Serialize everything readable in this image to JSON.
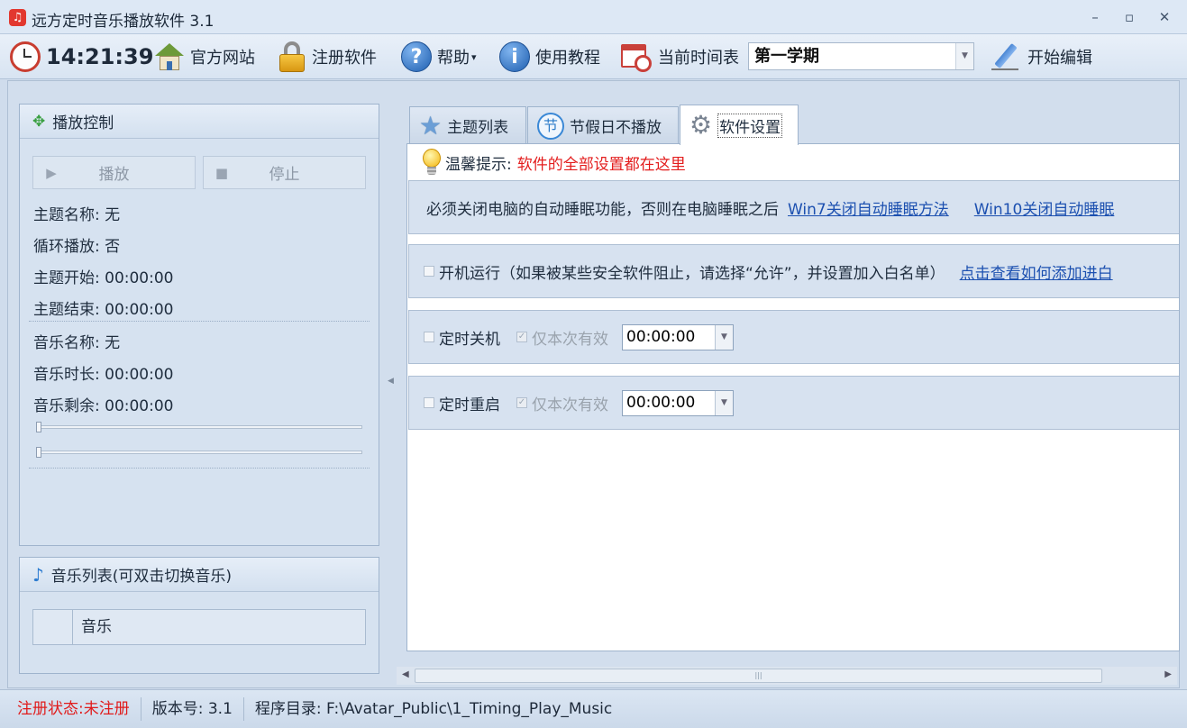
{
  "window": {
    "title": "远方定时音乐播放软件 3.1",
    "minimize": "–",
    "maximize": "▫",
    "close": "✕"
  },
  "toolbar": {
    "clock_time": "14:21:39",
    "official_site": "官方网站",
    "register": "注册软件",
    "help": "帮助",
    "help_arrow": "▾",
    "help_icon_glyph": "?",
    "tutorial": "使用教程",
    "tutorial_icon_glyph": "i",
    "schedule_label": "当前时间表",
    "schedule_value": "第一学期",
    "edit": "开始编辑"
  },
  "play_panel": {
    "title": "播放控制",
    "play_button": "播放",
    "stop_button": "停止",
    "theme_name": "主题名称: 无",
    "loop_play": "循环播放: 否",
    "theme_start": "主题开始: 00:00:00",
    "theme_end": "主题结束: 00:00:00",
    "music_name": "音乐名称: 无",
    "music_duration": "音乐时长: 00:00:00",
    "music_remaining": "音乐剩余: 00:00:00",
    "progress_value": 0,
    "volume_value": 0
  },
  "music_list_panel": {
    "title": "音乐列表(可双击切换音乐)",
    "column_header": "音乐"
  },
  "tabs": [
    {
      "label": "主题列表",
      "icon": "star-icon"
    },
    {
      "label": "节假日不播放",
      "icon": "holiday-icon",
      "icon_glyph": "节"
    },
    {
      "label": "软件设置",
      "icon": "gear-icon",
      "active": true
    }
  ],
  "settings": {
    "tip_label": "温馨提示:",
    "tip_text": "软件的全部设置都在这里",
    "sleep_notice": "必须关闭电脑的自动睡眠功能，否则在电脑睡眠之后",
    "win7_link": "Win7关闭自动睡眠方法",
    "win10_link": "Win10关闭自动睡眠",
    "autostart_label": "开机运行（如果被某些安全软件阻止，请选择“允许”，并设置加入白名单）",
    "whitelist_link": "点击查看如何添加进白",
    "shutdown_label": "定时关机",
    "shutdown_once_label": "仅本次有效",
    "shutdown_time": "00:00:00",
    "restart_label": "定时重启",
    "restart_once_label": "仅本次有效",
    "restart_time": "00:00:00"
  },
  "statusbar": {
    "reg_status": "注册状态:未注册",
    "version": "版本号: 3.1",
    "program_dir": "程序目录: F:\\Avatar_Public\\1_Timing_Play_Music"
  },
  "colors": {
    "accent_red": "#e01b1b",
    "link_blue": "#1c50b0",
    "panel_blue": "#d6e2f0"
  }
}
